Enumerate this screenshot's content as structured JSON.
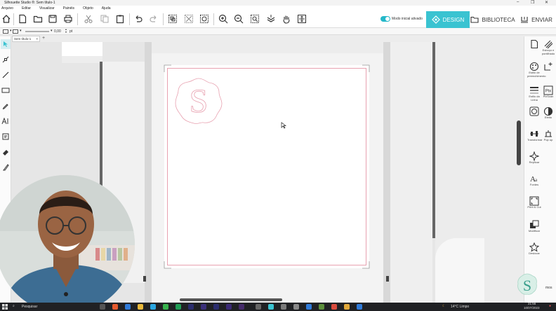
{
  "window": {
    "title": "Silhouette Studio ®: Sem título-1",
    "controls": [
      "–",
      "❐",
      "✕"
    ]
  },
  "menu": [
    "Arquivo",
    "Editar",
    "Visualizar",
    "Painéis",
    "Objeto",
    "Ajuda"
  ],
  "toolbar": {
    "toggle_label": "Modo inicial ativado",
    "tab_design": "DESIGN",
    "tab_biblioteca": "BIBLIOTECA",
    "tab_enviar": "ENVIAR"
  },
  "line_props": {
    "line_width_value": "0,00",
    "line_width_unit": "pt"
  },
  "document": {
    "tab_name": "Sem título-1",
    "add_tab": "+"
  },
  "right_panel": {
    "items": [
      {
        "label": "Esboço e pontilhado"
      },
      {
        "label": "Estilo de preenchimento"
      },
      {
        "label": "Estilo da Linha"
      },
      {
        "label": "PixScan"
      },
      {
        "label": "Efeito"
      },
      {
        "label": "Transformar"
      },
      {
        "label": "Pop up"
      },
      {
        "label": "Replicar"
      },
      {
        "label": "Fontes"
      },
      {
        "label": "Print & Cut"
      },
      {
        "label": "Modificar"
      },
      {
        "label": "Deslocar"
      }
    ],
    "partial_text": "mos"
  },
  "canvas": {
    "logo_letter": "S"
  },
  "taskbar": {
    "search_placeholder": "Pesquisar",
    "weather": "14°C  Limpo",
    "time": "21:56",
    "date": "10/07/2023"
  },
  "colors": {
    "accent": "#3ac3d1",
    "cut_line": "#e8a1b0",
    "taskbar": "#202124"
  }
}
